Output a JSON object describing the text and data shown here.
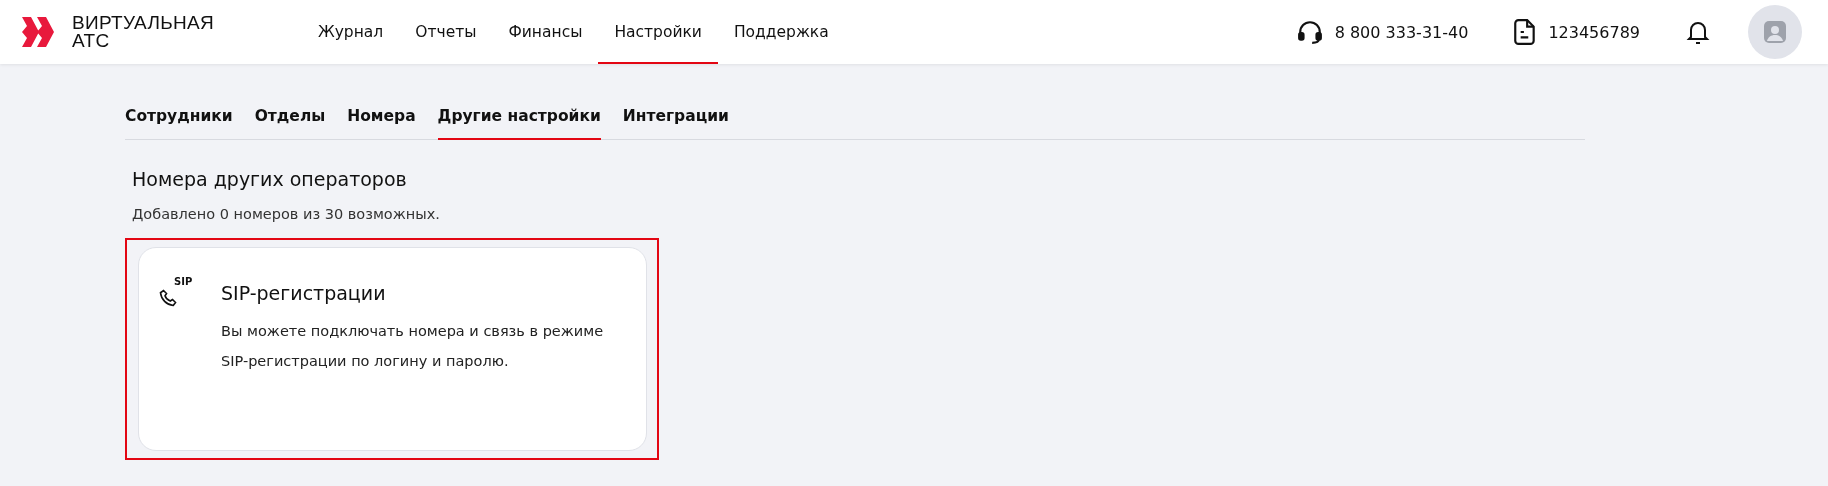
{
  "logo": {
    "line_1": "ВИРТУАЛЬНАЯ",
    "line_2": "АТС"
  },
  "nav": [
    {
      "label": "Журнал",
      "selected": false
    },
    {
      "label": "Отчеты",
      "selected": false
    },
    {
      "label": "Финансы",
      "selected": false
    },
    {
      "label": "Настройки",
      "selected": true
    },
    {
      "label": "Поддержка",
      "selected": false
    }
  ],
  "support_phone": "8 800 333-31-40",
  "contract_number": "123456789",
  "tabs": [
    {
      "label": "Сотрудники",
      "selected": false
    },
    {
      "label": "Отделы",
      "selected": false
    },
    {
      "label": "Номера",
      "selected": false
    },
    {
      "label": "Другие настройки",
      "selected": true
    },
    {
      "label": "Интеграции",
      "selected": false
    }
  ],
  "section": {
    "title": "Номера других операторов",
    "subtitle": "Добавлено 0 номеров из 30 возможных."
  },
  "cards": [
    {
      "icon_label": "SIP",
      "title": "SIP-регистрации",
      "description": "Вы можете подключать номера и связь в режиме SIP-регистрации по логину и паролю.",
      "highlighted": true
    }
  ]
}
